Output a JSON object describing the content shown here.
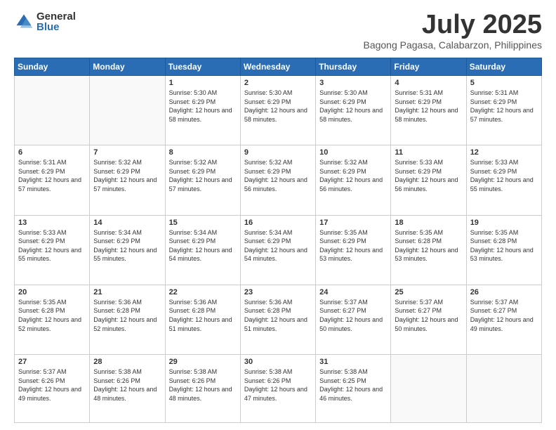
{
  "logo": {
    "general": "General",
    "blue": "Blue"
  },
  "header": {
    "month": "July 2025",
    "location": "Bagong Pagasa, Calabarzon, Philippines"
  },
  "days_of_week": [
    "Sunday",
    "Monday",
    "Tuesday",
    "Wednesday",
    "Thursday",
    "Friday",
    "Saturday"
  ],
  "weeks": [
    [
      {
        "day": "",
        "info": ""
      },
      {
        "day": "",
        "info": ""
      },
      {
        "day": "1",
        "info": "Sunrise: 5:30 AM\nSunset: 6:29 PM\nDaylight: 12 hours and 58 minutes."
      },
      {
        "day": "2",
        "info": "Sunrise: 5:30 AM\nSunset: 6:29 PM\nDaylight: 12 hours and 58 minutes."
      },
      {
        "day": "3",
        "info": "Sunrise: 5:30 AM\nSunset: 6:29 PM\nDaylight: 12 hours and 58 minutes."
      },
      {
        "day": "4",
        "info": "Sunrise: 5:31 AM\nSunset: 6:29 PM\nDaylight: 12 hours and 58 minutes."
      },
      {
        "day": "5",
        "info": "Sunrise: 5:31 AM\nSunset: 6:29 PM\nDaylight: 12 hours and 57 minutes."
      }
    ],
    [
      {
        "day": "6",
        "info": "Sunrise: 5:31 AM\nSunset: 6:29 PM\nDaylight: 12 hours and 57 minutes."
      },
      {
        "day": "7",
        "info": "Sunrise: 5:32 AM\nSunset: 6:29 PM\nDaylight: 12 hours and 57 minutes."
      },
      {
        "day": "8",
        "info": "Sunrise: 5:32 AM\nSunset: 6:29 PM\nDaylight: 12 hours and 57 minutes."
      },
      {
        "day": "9",
        "info": "Sunrise: 5:32 AM\nSunset: 6:29 PM\nDaylight: 12 hours and 56 minutes."
      },
      {
        "day": "10",
        "info": "Sunrise: 5:32 AM\nSunset: 6:29 PM\nDaylight: 12 hours and 56 minutes."
      },
      {
        "day": "11",
        "info": "Sunrise: 5:33 AM\nSunset: 6:29 PM\nDaylight: 12 hours and 56 minutes."
      },
      {
        "day": "12",
        "info": "Sunrise: 5:33 AM\nSunset: 6:29 PM\nDaylight: 12 hours and 55 minutes."
      }
    ],
    [
      {
        "day": "13",
        "info": "Sunrise: 5:33 AM\nSunset: 6:29 PM\nDaylight: 12 hours and 55 minutes."
      },
      {
        "day": "14",
        "info": "Sunrise: 5:34 AM\nSunset: 6:29 PM\nDaylight: 12 hours and 55 minutes."
      },
      {
        "day": "15",
        "info": "Sunrise: 5:34 AM\nSunset: 6:29 PM\nDaylight: 12 hours and 54 minutes."
      },
      {
        "day": "16",
        "info": "Sunrise: 5:34 AM\nSunset: 6:29 PM\nDaylight: 12 hours and 54 minutes."
      },
      {
        "day": "17",
        "info": "Sunrise: 5:35 AM\nSunset: 6:29 PM\nDaylight: 12 hours and 53 minutes."
      },
      {
        "day": "18",
        "info": "Sunrise: 5:35 AM\nSunset: 6:28 PM\nDaylight: 12 hours and 53 minutes."
      },
      {
        "day": "19",
        "info": "Sunrise: 5:35 AM\nSunset: 6:28 PM\nDaylight: 12 hours and 53 minutes."
      }
    ],
    [
      {
        "day": "20",
        "info": "Sunrise: 5:35 AM\nSunset: 6:28 PM\nDaylight: 12 hours and 52 minutes."
      },
      {
        "day": "21",
        "info": "Sunrise: 5:36 AM\nSunset: 6:28 PM\nDaylight: 12 hours and 52 minutes."
      },
      {
        "day": "22",
        "info": "Sunrise: 5:36 AM\nSunset: 6:28 PM\nDaylight: 12 hours and 51 minutes."
      },
      {
        "day": "23",
        "info": "Sunrise: 5:36 AM\nSunset: 6:28 PM\nDaylight: 12 hours and 51 minutes."
      },
      {
        "day": "24",
        "info": "Sunrise: 5:37 AM\nSunset: 6:27 PM\nDaylight: 12 hours and 50 minutes."
      },
      {
        "day": "25",
        "info": "Sunrise: 5:37 AM\nSunset: 6:27 PM\nDaylight: 12 hours and 50 minutes."
      },
      {
        "day": "26",
        "info": "Sunrise: 5:37 AM\nSunset: 6:27 PM\nDaylight: 12 hours and 49 minutes."
      }
    ],
    [
      {
        "day": "27",
        "info": "Sunrise: 5:37 AM\nSunset: 6:26 PM\nDaylight: 12 hours and 49 minutes."
      },
      {
        "day": "28",
        "info": "Sunrise: 5:38 AM\nSunset: 6:26 PM\nDaylight: 12 hours and 48 minutes."
      },
      {
        "day": "29",
        "info": "Sunrise: 5:38 AM\nSunset: 6:26 PM\nDaylight: 12 hours and 48 minutes."
      },
      {
        "day": "30",
        "info": "Sunrise: 5:38 AM\nSunset: 6:26 PM\nDaylight: 12 hours and 47 minutes."
      },
      {
        "day": "31",
        "info": "Sunrise: 5:38 AM\nSunset: 6:25 PM\nDaylight: 12 hours and 46 minutes."
      },
      {
        "day": "",
        "info": ""
      },
      {
        "day": "",
        "info": ""
      }
    ]
  ]
}
